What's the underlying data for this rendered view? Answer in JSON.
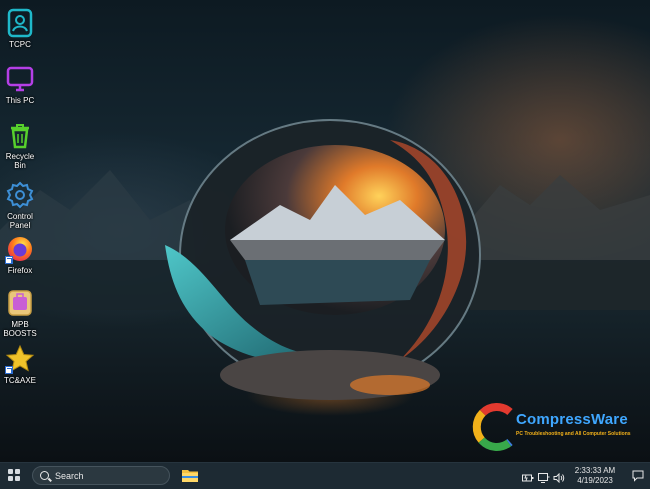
{
  "desktop": {
    "icons": [
      {
        "label": "TCPC",
        "icon": "user-folder-icon"
      },
      {
        "label": "This PC",
        "icon": "monitor-icon"
      },
      {
        "label": "Recycle Bin",
        "icon": "trash-icon"
      },
      {
        "label": "Control Panel",
        "icon": "gear-icon"
      },
      {
        "label": "Firefox",
        "icon": "firefox-icon"
      },
      {
        "label": "MPB BOOSTS",
        "icon": "bag-icon"
      },
      {
        "label": "TC&AXE",
        "icon": "star-icon"
      }
    ]
  },
  "watermark": {
    "name": "CompressWare",
    "tagline": "PC Troubleshooting and All Computer Solutions"
  },
  "taskbar": {
    "search_placeholder": "Search",
    "pinned": [
      "file-explorer-icon"
    ],
    "tray_icons": [
      "battery-icon",
      "network-icon",
      "volume-icon"
    ],
    "time": "2:33:33 AM",
    "date": "4/19/2023",
    "notification_icon": "notification-icon"
  },
  "colors": {
    "taskbar": "#1d2a33",
    "icon_teal": "#1fb8c9",
    "icon_purple": "#b43fe6",
    "icon_green": "#57d02c",
    "logo_blue": "#3fa7ff",
    "logo_orange": "#f2b11a"
  }
}
